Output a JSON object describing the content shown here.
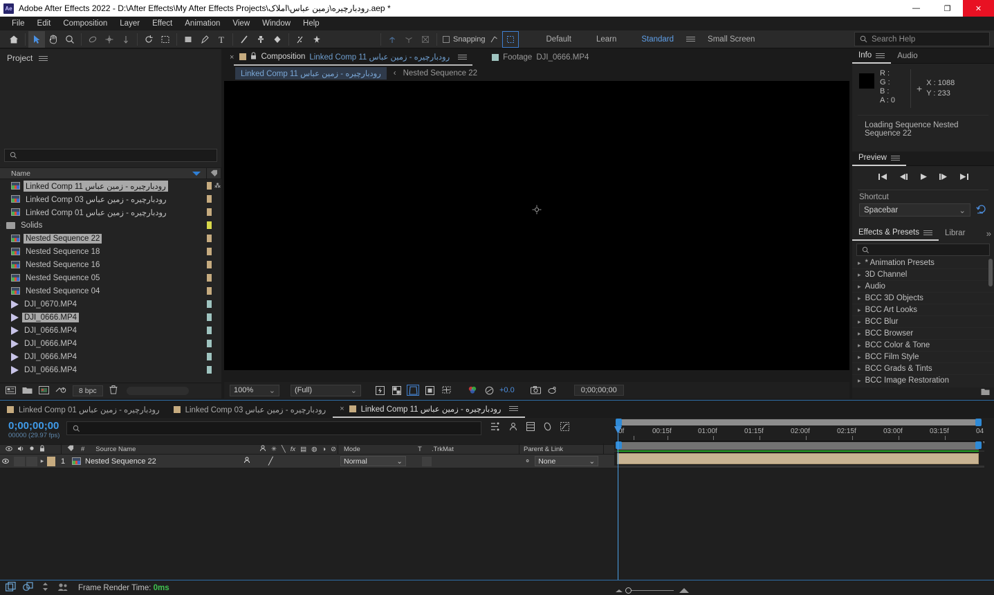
{
  "window": {
    "title": "Adobe After Effects 2022 - D:\\After Effects\\My After Effects Projects\\رودبارچیره\\زمین عباس\\املاک.aep *",
    "logo": "Ae",
    "minimize": "—",
    "maximize": "❐",
    "close": "✕"
  },
  "menubar": {
    "items": [
      "File",
      "Edit",
      "Composition",
      "Layer",
      "Effect",
      "Animation",
      "View",
      "Window",
      "Help"
    ]
  },
  "toolbar": {
    "tools": [
      {
        "name": "home-icon",
        "glyph": "⌂"
      },
      {
        "name": "selection-tool-icon",
        "glyph": "➤"
      },
      {
        "name": "hand-tool-icon",
        "glyph": "✋"
      },
      {
        "name": "zoom-tool-icon",
        "glyph": "🔍"
      },
      {
        "name": "orbit-tool-icon",
        "glyph": "◐"
      },
      {
        "name": "pan-behind-tool-icon",
        "glyph": "✛"
      },
      {
        "name": "dolly-tool-icon",
        "glyph": "↧"
      },
      {
        "name": "rotation-tool-icon",
        "glyph": "↺"
      },
      {
        "name": "region-of-interest-icon",
        "glyph": "⬚"
      },
      {
        "name": "shape-tool-icon",
        "glyph": "▢"
      },
      {
        "name": "pen-tool-icon",
        "glyph": "✒"
      },
      {
        "name": "type-tool-icon",
        "glyph": "T"
      },
      {
        "name": "brush-tool-icon",
        "glyph": "╱"
      },
      {
        "name": "clone-stamp-tool-icon",
        "glyph": "⊥"
      },
      {
        "name": "eraser-tool-icon",
        "glyph": "◆"
      },
      {
        "name": "roto-brush-tool-icon",
        "glyph": "⋰"
      },
      {
        "name": "puppet-pin-tool-icon",
        "glyph": "✦"
      }
    ],
    "snapping_label": "Snapping",
    "workspaces": [
      "Default",
      "Learn",
      "Standard",
      "Small Screen"
    ],
    "workspace_selected": "Standard",
    "overflow": "»",
    "search_help_placeholder": "Search Help"
  },
  "project": {
    "title": "Project",
    "search_placeholder": "",
    "column_name": "Name",
    "items": [
      {
        "label": "رودبارچیره - زمین عباس Linked Comp 11",
        "icon": "comp-icon",
        "selected": true,
        "swatch": "#c6ab7f",
        "indent": 0
      },
      {
        "label": "رودبارچیره - زمین عباس Linked Comp 03",
        "icon": "comp-icon",
        "selected": false,
        "swatch": "#c6ab7f",
        "indent": 0
      },
      {
        "label": "رودبارچیره - زمین عباس Linked Comp 01",
        "icon": "comp-icon",
        "selected": false,
        "swatch": "#c6ab7f",
        "indent": 0
      },
      {
        "label": "Solids",
        "icon": "folder-icon",
        "selected": false,
        "swatch": "#d8d84a",
        "indent": 0,
        "expandable": true
      },
      {
        "label": "Nested Sequence 22",
        "icon": "comp-icon",
        "selected": true,
        "swatch": "#c6ab7f",
        "indent": 0
      },
      {
        "label": "Nested Sequence 18",
        "icon": "comp-icon",
        "selected": false,
        "swatch": "#c6ab7f",
        "indent": 0
      },
      {
        "label": "Nested Sequence 16",
        "icon": "comp-icon",
        "selected": false,
        "swatch": "#c6ab7f",
        "indent": 0
      },
      {
        "label": "Nested Sequence 05",
        "icon": "comp-icon",
        "selected": false,
        "swatch": "#c6ab7f",
        "indent": 0
      },
      {
        "label": "Nested Sequence 04",
        "icon": "comp-icon",
        "selected": false,
        "swatch": "#c6ab7f",
        "indent": 0
      },
      {
        "label": "DJI_0670.MP4",
        "icon": "video-icon",
        "selected": false,
        "swatch": "#9fc4c0",
        "indent": 0
      },
      {
        "label": "DJI_0666.MP4",
        "icon": "video-icon",
        "selected": true,
        "swatch": "#9fc4c0",
        "indent": 0
      },
      {
        "label": "DJI_0666.MP4",
        "icon": "video-icon",
        "selected": false,
        "swatch": "#9fc4c0",
        "indent": 0
      },
      {
        "label": "DJI_0666.MP4",
        "icon": "video-icon",
        "selected": false,
        "swatch": "#9fc4c0",
        "indent": 0
      },
      {
        "label": "DJI_0666.MP4",
        "icon": "video-icon",
        "selected": false,
        "swatch": "#9fc4c0",
        "indent": 0
      },
      {
        "label": "DJI_0666.MP4",
        "icon": "video-icon",
        "selected": false,
        "swatch": "#9fc4c0",
        "indent": 0
      }
    ],
    "footer": {
      "bit_depth": "8 bpc"
    }
  },
  "composition": {
    "tab_prefix": "Composition",
    "tab_title": "رودبارچیره - زمین عباس Linked Comp 11",
    "footage_tab_prefix": "Footage",
    "footage_tab_title": "DJI_0666.MP4",
    "breadcrumb_comp": "رودبارچیره - زمین عباس Linked Comp 11",
    "breadcrumb_arrow": "‹",
    "breadcrumb_nested": "Nested Sequence 22",
    "zoom_level": "100%",
    "resolution": "(Full)",
    "exposure": "+0.0",
    "timecode": "0;00;00;00"
  },
  "info": {
    "tab": "Info",
    "tab_audio": "Audio",
    "r_label": "R :",
    "g_label": "G :",
    "b_label": "B :",
    "a_label": "A :",
    "a_value": "0",
    "x_label": "X : 1088",
    "y_label": "Y : 233",
    "status": "Loading Sequence Nested Sequence 22"
  },
  "preview": {
    "tab": "Preview",
    "shortcut_label": "Shortcut",
    "shortcut_value": "Spacebar",
    "transport": [
      "first-frame-icon",
      "prev-frame-icon",
      "play-icon",
      "next-frame-icon",
      "last-frame-icon"
    ]
  },
  "effects": {
    "tab": "Effects & Presets",
    "tab_libraries": "Librar",
    "search_placeholder": "",
    "items": [
      "* Animation Presets",
      "3D Channel",
      "Audio",
      "BCC 3D Objects",
      "BCC Art Looks",
      "BCC Blur",
      "BCC Browser",
      "BCC Color & Tone",
      "BCC Film Style",
      "BCC Grads & Tints",
      "BCC Image Restoration"
    ]
  },
  "timeline": {
    "tabs": [
      {
        "label": "رودبارچیره - زمین عباس Linked Comp 01",
        "selected": false,
        "closable": false
      },
      {
        "label": "رودبارچیره - زمین عباس Linked Comp 03",
        "selected": false,
        "closable": false
      },
      {
        "label": "رودبارچیره - زمین عباس Linked Comp 11",
        "selected": true,
        "closable": true
      }
    ],
    "current_time": "0;00;00;00",
    "frame_info": "00000 (29.97 fps)",
    "search_placeholder": "",
    "columns": [
      "#",
      "Source Name",
      "Mode",
      "T",
      "TrkMat",
      "Parent & Link"
    ],
    "layers": [
      {
        "index": "1",
        "source_name": "Nested Sequence 22",
        "mode": "Normal",
        "trkmat": "",
        "parent": "None",
        "label_color": "#c6ab7f"
      }
    ],
    "ruler_ticks": [
      "0f",
      "00:15f",
      "01:00f",
      "01:15f",
      "02:00f",
      "02:15f",
      "03:00f",
      "03:15f",
      "04"
    ]
  },
  "statusbar": {
    "frame_render_label": "Frame Render Time:",
    "frame_render_value": "0ms"
  }
}
